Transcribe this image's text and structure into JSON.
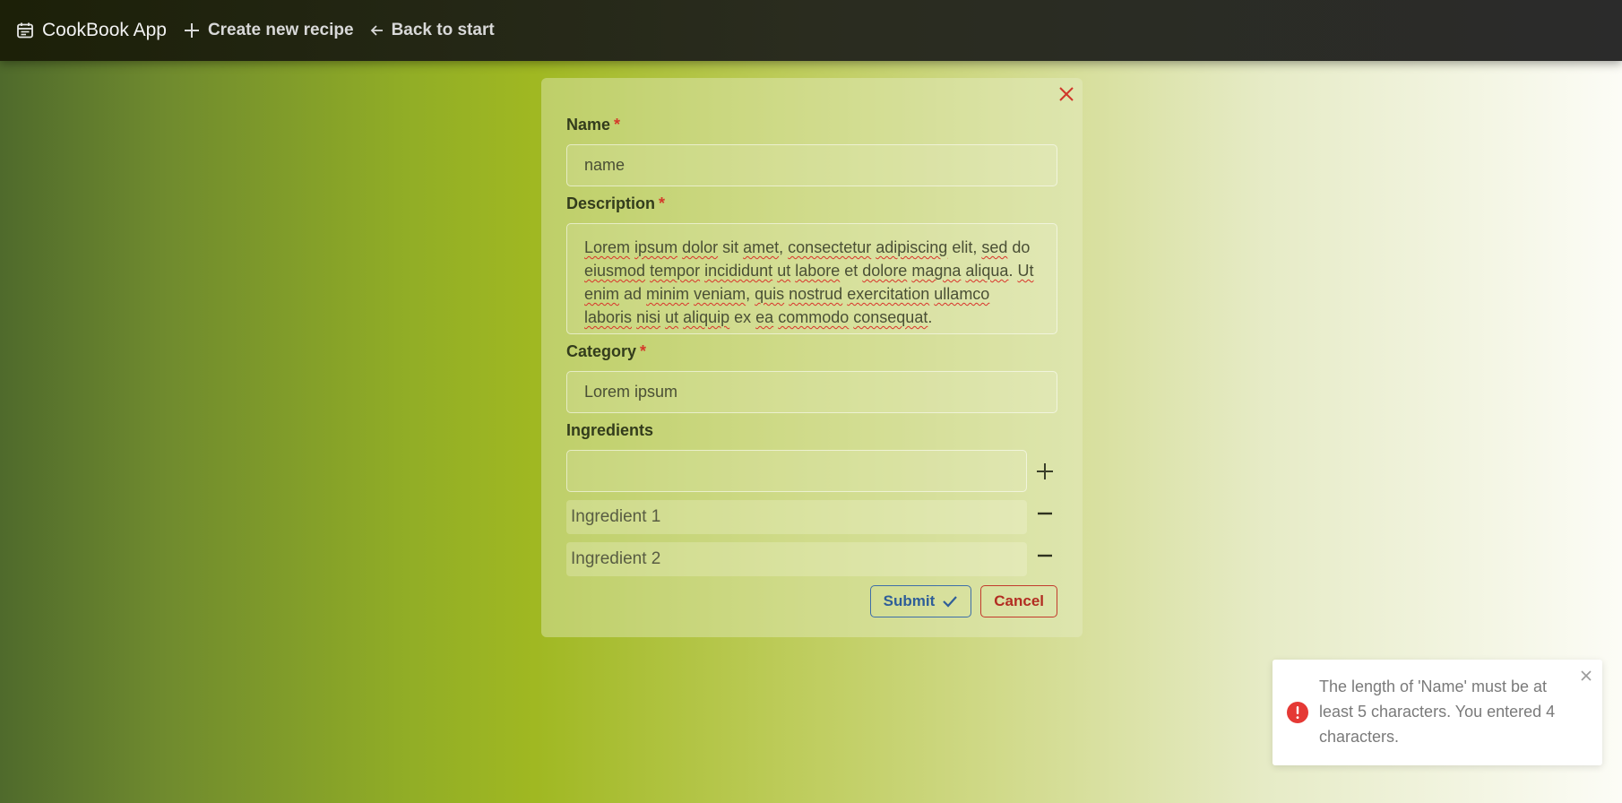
{
  "navbar": {
    "brand": "CookBook App",
    "create_label": "Create new recipe",
    "back_label": "Back to start"
  },
  "form": {
    "name": {
      "label": "Name",
      "required_mark": "*",
      "value": "name"
    },
    "description": {
      "label": "Description",
      "required_mark": "*",
      "value_words": [
        {
          "t": "Lorem",
          "sp": true
        },
        {
          "t": " "
        },
        {
          "t": "ipsum",
          "sp": true
        },
        {
          "t": " "
        },
        {
          "t": "dolor",
          "sp": true
        },
        {
          "t": " sit "
        },
        {
          "t": "amet",
          "sp": true
        },
        {
          "t": ", "
        },
        {
          "t": "consectetur",
          "sp": true
        },
        {
          "t": " "
        },
        {
          "t": "adipiscing",
          "sp": true
        },
        {
          "t": " elit, "
        },
        {
          "t": "sed",
          "sp": true
        },
        {
          "t": " do "
        },
        {
          "t": "eiusmod",
          "sp": true
        },
        {
          "t": " "
        },
        {
          "t": "tempor",
          "sp": true
        },
        {
          "t": " "
        },
        {
          "t": "incididunt",
          "sp": true
        },
        {
          "t": " "
        },
        {
          "t": "ut",
          "sp": true
        },
        {
          "t": " "
        },
        {
          "t": "labore",
          "sp": true
        },
        {
          "t": " et "
        },
        {
          "t": "dolore",
          "sp": true
        },
        {
          "t": " "
        },
        {
          "t": "magna",
          "sp": true
        },
        {
          "t": " "
        },
        {
          "t": "aliqua",
          "sp": true
        },
        {
          "t": ". "
        },
        {
          "t": "Ut",
          "sp": true
        },
        {
          "t": " "
        },
        {
          "t": "enim",
          "sp": true
        },
        {
          "t": " ad "
        },
        {
          "t": "minim",
          "sp": true
        },
        {
          "t": " "
        },
        {
          "t": "veniam",
          "sp": true
        },
        {
          "t": ", "
        },
        {
          "t": "quis",
          "sp": true
        },
        {
          "t": " "
        },
        {
          "t": "nostrud",
          "sp": true
        },
        {
          "t": " "
        },
        {
          "t": "exercitation",
          "sp": true
        },
        {
          "t": " "
        },
        {
          "t": "ullamco",
          "sp": true
        },
        {
          "t": " "
        },
        {
          "t": "laboris",
          "sp": true
        },
        {
          "t": " "
        },
        {
          "t": "nisi",
          "sp": true
        },
        {
          "t": " "
        },
        {
          "t": "ut",
          "sp": true
        },
        {
          "t": " "
        },
        {
          "t": "aliquip",
          "sp": true
        },
        {
          "t": " ex "
        },
        {
          "t": "ea",
          "sp": true
        },
        {
          "t": " "
        },
        {
          "t": "commodo",
          "sp": true
        },
        {
          "t": " "
        },
        {
          "t": "consequat",
          "sp": true
        },
        {
          "t": "."
        }
      ]
    },
    "category": {
      "label": "Category",
      "required_mark": "*",
      "value": "Lorem ipsum"
    },
    "ingredients": {
      "label": "Ingredients",
      "new_value": "",
      "items": [
        "Ingredient 1",
        "Ingredient 2"
      ]
    },
    "submit_label": "Submit",
    "cancel_label": "Cancel"
  },
  "toast": {
    "message": "The length of 'Name' must be at least 5 characters. You entered 4 characters."
  },
  "colors": {
    "required": "#d43a2a",
    "submit_border": "#3d6ea8",
    "cancel_border": "#c23a2c",
    "error_icon": "#e53935"
  },
  "icons": {
    "brand": "calendar-icon",
    "create": "plus-icon",
    "back": "arrow-left-icon",
    "close_form": "close-icon",
    "add_ingredient": "plus-icon",
    "remove_ingredient": "minus-icon",
    "submit": "check-icon",
    "toast": "error-icon",
    "toast_close": "close-icon"
  }
}
